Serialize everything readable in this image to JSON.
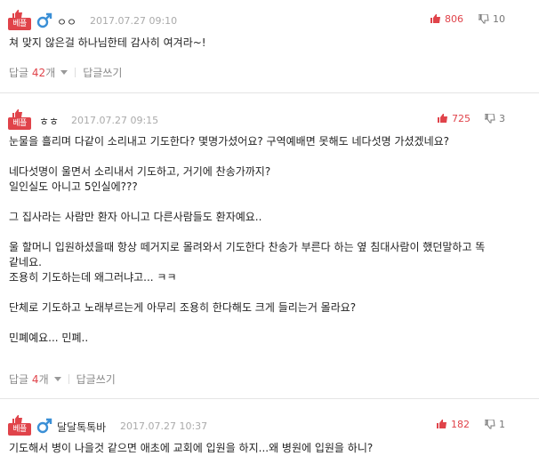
{
  "labels": {
    "best_badge": "베플",
    "reply": "답글",
    "write_reply": "답글쓰기"
  },
  "colors": {
    "accent_red": "#e0434a",
    "male_blue": "#3a8fd6",
    "date_gray": "#aaaaaa"
  },
  "comments": [
    {
      "gender_icon": "male-icon",
      "nickname": "ㅇㅇ",
      "date": "2017.07.27 09:10",
      "upvotes": "806",
      "downvotes": "10",
      "body": "쳐 맞지 않은걸 하나님한테 감사히 여겨라~!",
      "reply_count": "42",
      "reply_unit": "개"
    },
    {
      "gender_icon": "",
      "nickname": "ㅎㅎ",
      "date": "2017.07.27 09:15",
      "upvotes": "725",
      "downvotes": "3",
      "body": [
        "눈물을 흘리며 다같이 소리내고 기도한다? 몇명가셨어요? 구역예배면 못해도 네다섯명 가셨겠네요?",
        "",
        "네다섯명이 울면서 소리내서 기도하고, 거기에 찬송가까지?",
        "일인실도 아니고 5인실에???",
        "",
        "그 집사라는 사람만 환자 아니고 다른사람들도 환자예요..",
        "",
        "울 할머니 입원하셨을때 항상 떼거지로 몰려와서 기도한다 찬송가 부른다 하는 옆 침대사람이 했던말하고 똑",
        "같네요.",
        "조용히 기도하는데 왜그러냐고... ㅋㅋ",
        "",
        "단체로 기도하고 노래부르는게 아무리 조용히 한다해도 크게 들리는거 몰라요?",
        "",
        "민폐예요... 민폐.."
      ],
      "reply_count": "4",
      "reply_unit": "개"
    },
    {
      "gender_icon": "male-icon",
      "nickname": "달달톡톡바",
      "date": "2017.07.27 10:37",
      "upvotes": "182",
      "downvotes": "1",
      "body": "기도해서 병이 나을것 같으면 애초에 교회에 입원을 하지...왜 병원에 입원을 하니?"
    }
  ]
}
